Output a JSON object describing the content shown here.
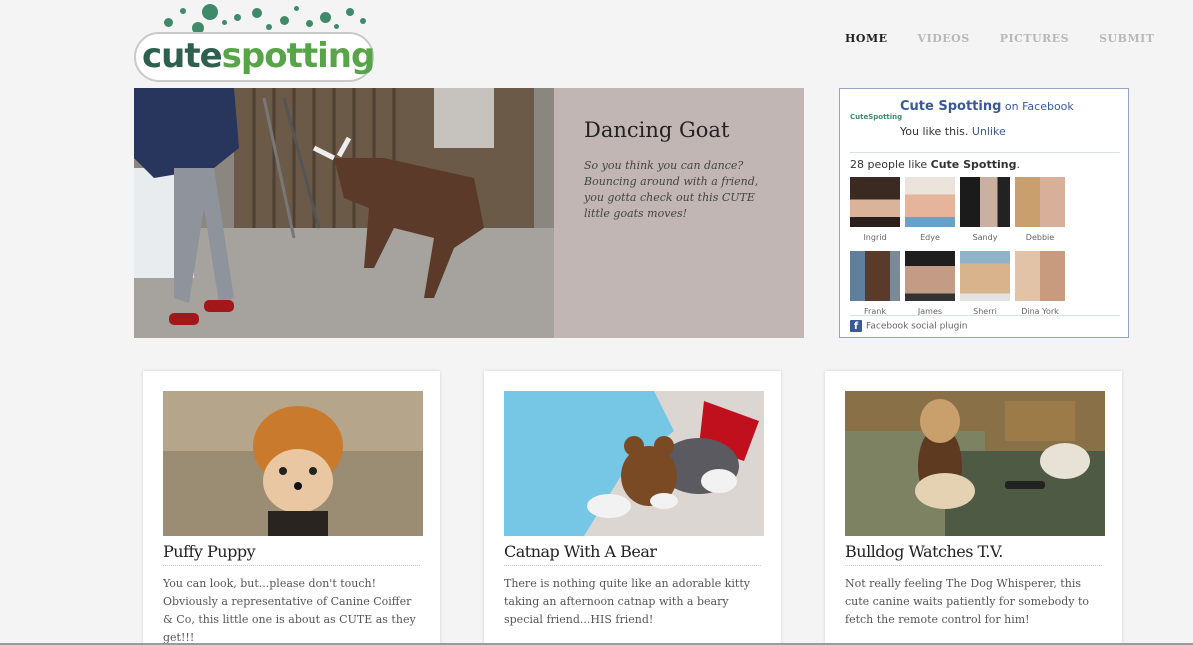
{
  "logo": {
    "cute": "cute",
    "spotting": "spotting"
  },
  "nav": {
    "items": [
      {
        "label": "HOME",
        "active": true
      },
      {
        "label": "VIDEOS",
        "active": false
      },
      {
        "label": "PICTURES",
        "active": false
      },
      {
        "label": "SUBMIT",
        "active": false
      }
    ]
  },
  "feature": {
    "title": "Dancing Goat",
    "description": "So you think you can dance? Bouncing around with a friend, you gotta check out this CUTE little goats moves!"
  },
  "facebook": {
    "logo_text": "CuteSpotting",
    "page_name": "Cute Spotting",
    "on_text": " on Facebook",
    "you_like": "You like this. ",
    "unlike": "Unlike",
    "count_prefix": "28 people like ",
    "count_page": "Cute Spotting",
    "count_suffix": ".",
    "faces": [
      {
        "name": "Ingrid"
      },
      {
        "name": "Edye"
      },
      {
        "name": "Sandy"
      },
      {
        "name": "Debbie"
      },
      {
        "name": "Frank"
      },
      {
        "name": "James"
      },
      {
        "name": "Sherri"
      },
      {
        "name": "Dina York"
      }
    ],
    "footer": "Facebook social plugin",
    "f_glyph": "f"
  },
  "cards": [
    {
      "title": "Puffy Puppy",
      "description": "You can look, but...please don't touch! Obviously a representative of Canine Coiffer & Co, this little one is about as CUTE as they get!!!"
    },
    {
      "title": "Catnap With A Bear",
      "description": "There is nothing quite like an adorable kitty taking an afternoon catnap with a beary special friend...HIS friend!"
    },
    {
      "title": "Bulldog Watches T.V.",
      "description": "Not really feeling The Dog Whisperer, this cute canine waits patiently for somebody to fetch the remote control for him!"
    }
  ],
  "colors": {
    "brand_dark": "#2f5f4e",
    "brand_green": "#57a548",
    "facebook_blue": "#3b5998",
    "feature_panel": "#c1b6b4"
  }
}
